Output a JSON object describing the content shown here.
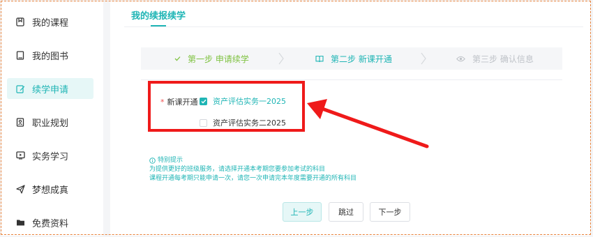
{
  "sidebar": {
    "items": [
      {
        "label": "我的课程",
        "icon": "bookmark-icon",
        "active": false
      },
      {
        "label": "我的图书",
        "icon": "book-icon",
        "active": false
      },
      {
        "label": "续学申请",
        "icon": "edit-icon",
        "active": true
      },
      {
        "label": "职业规划",
        "icon": "id-card-icon",
        "active": false
      },
      {
        "label": "实务学习",
        "icon": "video-icon",
        "active": false
      },
      {
        "label": "梦想成真",
        "icon": "paper-plane-icon",
        "active": false
      },
      {
        "label": "免费资料",
        "icon": "folder-icon",
        "active": false
      }
    ]
  },
  "main": {
    "title": "我的续报续学",
    "steps": [
      {
        "label": "第一步 申请续学",
        "state": "done",
        "icon": "check-icon"
      },
      {
        "label": "第二步 新课开通",
        "state": "current",
        "icon": "open-book-icon"
      },
      {
        "label": "第三步 确认信息",
        "state": "pending",
        "icon": "eye-icon"
      }
    ],
    "form": {
      "required_mark": "*",
      "label": "新课开通",
      "options": [
        {
          "label": "资产评估实务一2025",
          "checked": true
        },
        {
          "label": "资产评估实务二2025",
          "checked": false
        }
      ]
    },
    "notice": {
      "title": "特别提示",
      "lines": [
        "为提供更好的班级服务，请选择开通本考期您要参加考试的科目",
        "课程开通每考期只能申请一次，请您一次申请完本年度需要开通的所有科目"
      ]
    },
    "buttons": {
      "prev": "上一步",
      "skip": "跳过",
      "next": "下一步"
    }
  },
  "colors": {
    "accent": "#1fb5b5",
    "done": "#7fc241",
    "pending": "#bfc3c8",
    "annotation": "#ef1a1a",
    "frame": "#e8823a"
  }
}
